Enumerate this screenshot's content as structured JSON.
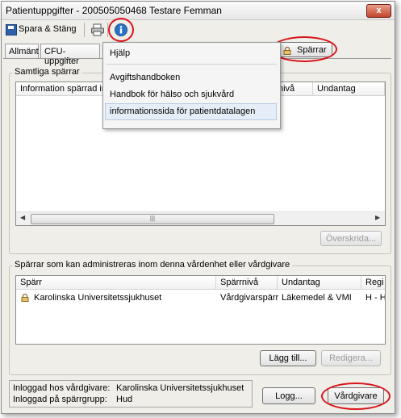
{
  "window": {
    "title": "Patientuppgifter - 200505050468 Testare Femman",
    "close_glyph": "x"
  },
  "toolbar": {
    "save_label": "Spara & Stäng",
    "print_icon": "printer-icon",
    "info_icon": "info-icon"
  },
  "tabs": [
    {
      "label": "Allmänt"
    },
    {
      "label": "CFU-uppgifter"
    }
  ],
  "sparrar_button": {
    "label": "Spärrar"
  },
  "info_menu": {
    "title": "Hjälp",
    "items": [
      {
        "label": "Avgiftshandboken"
      },
      {
        "label": "Handbok för hälso och sjukvård"
      },
      {
        "label": "informationssida för patientdatalagen"
      }
    ]
  },
  "all_blocks": {
    "legend": "Samtliga spärrar",
    "columns": [
      "Information spärrad in",
      "nivå",
      "Undantag"
    ],
    "override_button": "Överskrida..."
  },
  "admin_blocks": {
    "legend": "Spärrar som kan administreras inom denna vårdenhet eller vårdgivare",
    "columns": [
      "Spärr",
      "Spärrnivå",
      "Undantag",
      "Regi"
    ],
    "rows": [
      {
        "sparr": "Karolinska Universitetssjukhuset",
        "niva": "Vårdgivarspärr",
        "undantag": "Läkemedel & VMI",
        "regi": "H - H"
      }
    ],
    "add_button": "Lägg till...",
    "edit_button": "Redigera..."
  },
  "status": {
    "vardgivare_label": "Inloggad hos vårdgivare:",
    "vardgivare_value": "Karolinska Universitetssjukhuset",
    "sparrgrupp_label": "Inloggad på spärrgrupp:",
    "sparrgrupp_value": "Hud"
  },
  "footer": {
    "log_button": "Logg...",
    "vardgivare_button": "Vårdgivare"
  },
  "colors": {
    "highlight_ring": "#d8141b",
    "info_blue": "#2a72c8"
  }
}
